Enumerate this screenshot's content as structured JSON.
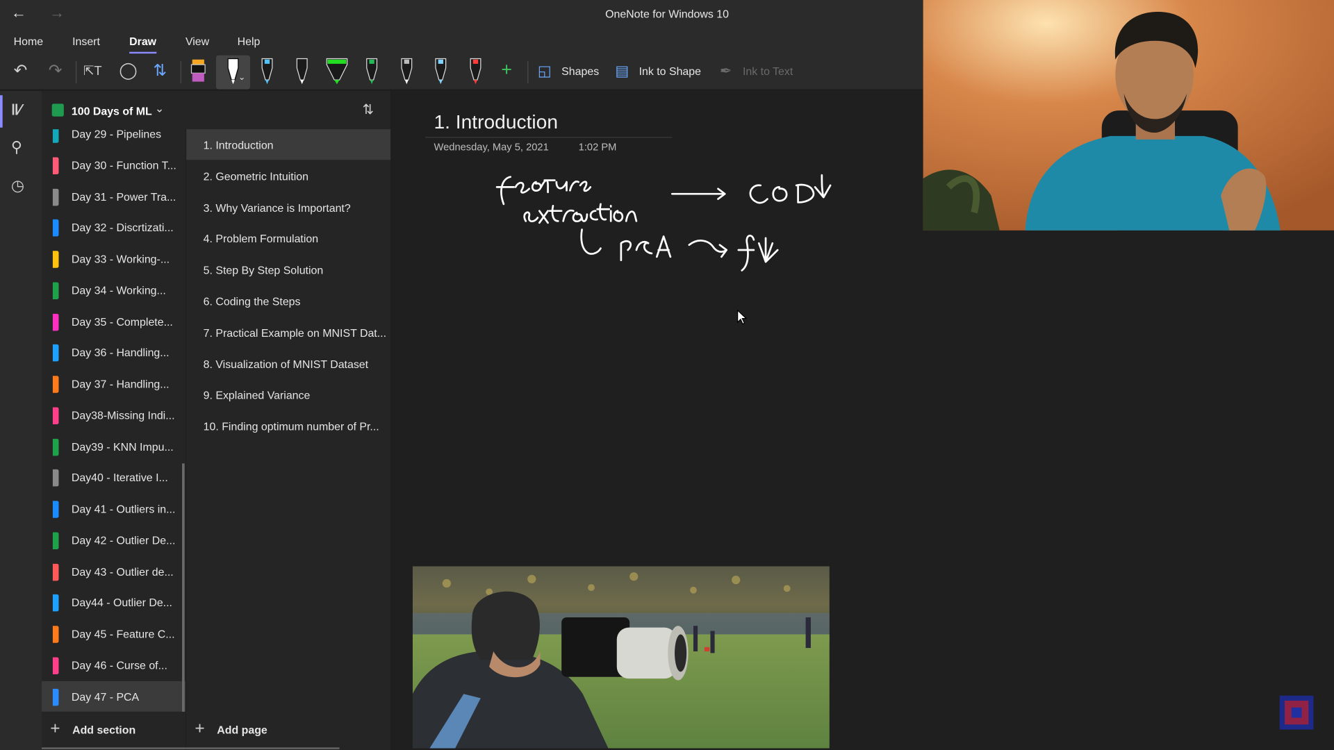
{
  "window": {
    "title": "OneNote for Windows 10"
  },
  "menu": {
    "items": [
      "Home",
      "Insert",
      "Draw",
      "View",
      "Help"
    ],
    "active": "Draw"
  },
  "toolbar": {
    "shapes_label": "Shapes",
    "ink_to_shape_label": "Ink to Shape",
    "ink_to_text_label": "Ink to Text",
    "pens": [
      {
        "name": "highlighter-pen",
        "color": "#f5a623"
      },
      {
        "name": "white-pen",
        "color": "#ffffff"
      },
      {
        "name": "blue-pen",
        "color": "#4fc3f7"
      },
      {
        "name": "black-pen",
        "color": "#ffffff"
      },
      {
        "name": "green-highlighter",
        "color": "#22dd22"
      },
      {
        "name": "green-pen",
        "color": "#22bb55"
      },
      {
        "name": "gray-pen",
        "color": "#cccccc"
      },
      {
        "name": "light-blue-pen",
        "color": "#7fd3ff"
      },
      {
        "name": "red-pen",
        "color": "#ff3b3b"
      }
    ]
  },
  "notebook": {
    "name": "100 Days of ML"
  },
  "sections": [
    {
      "label": "Day 29 - Pipelines",
      "color": "#13a9b8"
    },
    {
      "label": "Day 30 - Function T...",
      "color": "#ff5a78"
    },
    {
      "label": "Day 31 - Power Tra...",
      "color": "#8a8a8a"
    },
    {
      "label": "Day 32 - Discrtizati...",
      "color": "#1a8cff"
    },
    {
      "label": "Day 33 - Working-...",
      "color": "#ffc20e"
    },
    {
      "label": "Day 34 - Working...",
      "color": "#1fa34a"
    },
    {
      "label": "Day 35 - Complete...",
      "color": "#ff2fc0"
    },
    {
      "label": "Day 36 - Handling...",
      "color": "#1ea0ff"
    },
    {
      "label": "Day 37 - Handling...",
      "color": "#ff7a1a"
    },
    {
      "label": "Day38-Missing Indi...",
      "color": "#ff3f8a"
    },
    {
      "label": "Day39 - KNN Impu...",
      "color": "#1fa34a"
    },
    {
      "label": "Day40 - Iterative I...",
      "color": "#8a8a8a"
    },
    {
      "label": "Day 41 - Outliers in...",
      "color": "#1a8cff"
    },
    {
      "label": "Day 42 - Outlier De...",
      "color": "#1fa34a"
    },
    {
      "label": "Day 43 - Outlier de...",
      "color": "#ff5a5a"
    },
    {
      "label": "Day44 - Outlier De...",
      "color": "#1ea0ff"
    },
    {
      "label": "Day 45 - Feature C...",
      "color": "#ff7a1a"
    },
    {
      "label": "Day 46 - Curse of...",
      "color": "#ff3f8a"
    },
    {
      "label": "Day 47 - PCA",
      "color": "#2b8cff"
    }
  ],
  "selected_section": "Day 47 - PCA",
  "pages": [
    "1. Introduction",
    "2. Geometric Intuition",
    "3. Why Variance is Important?",
    "4. Problem Formulation",
    "5. Step By Step Solution",
    "6. Coding the Steps",
    "7. Practical Example on MNIST Dat...",
    "8. Visualization of MNIST Dataset",
    "9. Explained Variance",
    "10. Finding optimum number of Pr..."
  ],
  "selected_page": "1. Introduction",
  "bottom": {
    "add_section_label": "Add section",
    "add_page_label": "Add page"
  },
  "page": {
    "title": "1. Introduction",
    "date": "Wednesday, May 5, 2021",
    "time": "1:02 PM"
  }
}
